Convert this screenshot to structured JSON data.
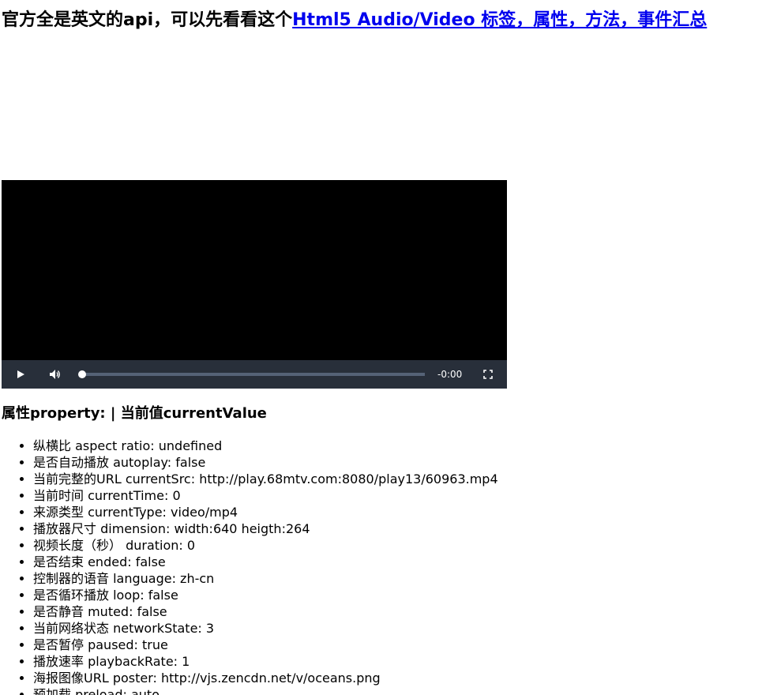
{
  "header": {
    "text": "官方全是英文的api，可以先看看这个",
    "link_text": "Html5 Audio/Video 标签，属性，方法，事件汇总"
  },
  "player": {
    "play_icon": "play-icon",
    "volume_icon": "volume-icon",
    "remaining_time": "-0:00",
    "fullscreen_icon": "fullscreen-icon",
    "progress": 0
  },
  "properties": {
    "title": "属性property: | 当前值currentValue",
    "items": [
      "纵横比 aspect ratio: undefined",
      "是否自动播放 autoplay: false",
      "当前完整的URL currentSrc: http://play.68mtv.com:8080/play13/60963.mp4",
      "当前时间 currentTime: 0",
      "来源类型 currentType: video/mp4",
      "播放器尺寸 dimension: width:640 heigth:264",
      "视频长度（秒） duration: 0",
      "是否结束 ended: false",
      "控制器的语音 language: zh-cn",
      "是否循环播放 loop: false",
      "是否静音 muted: false",
      "当前网络状态 networkState: 3",
      "是否暂停 paused: true",
      "播放速率 playbackRate: 1",
      "海报图像URL poster: http://vjs.zencdn.net/v/oceans.png",
      "预加载 preload: auto"
    ]
  }
}
